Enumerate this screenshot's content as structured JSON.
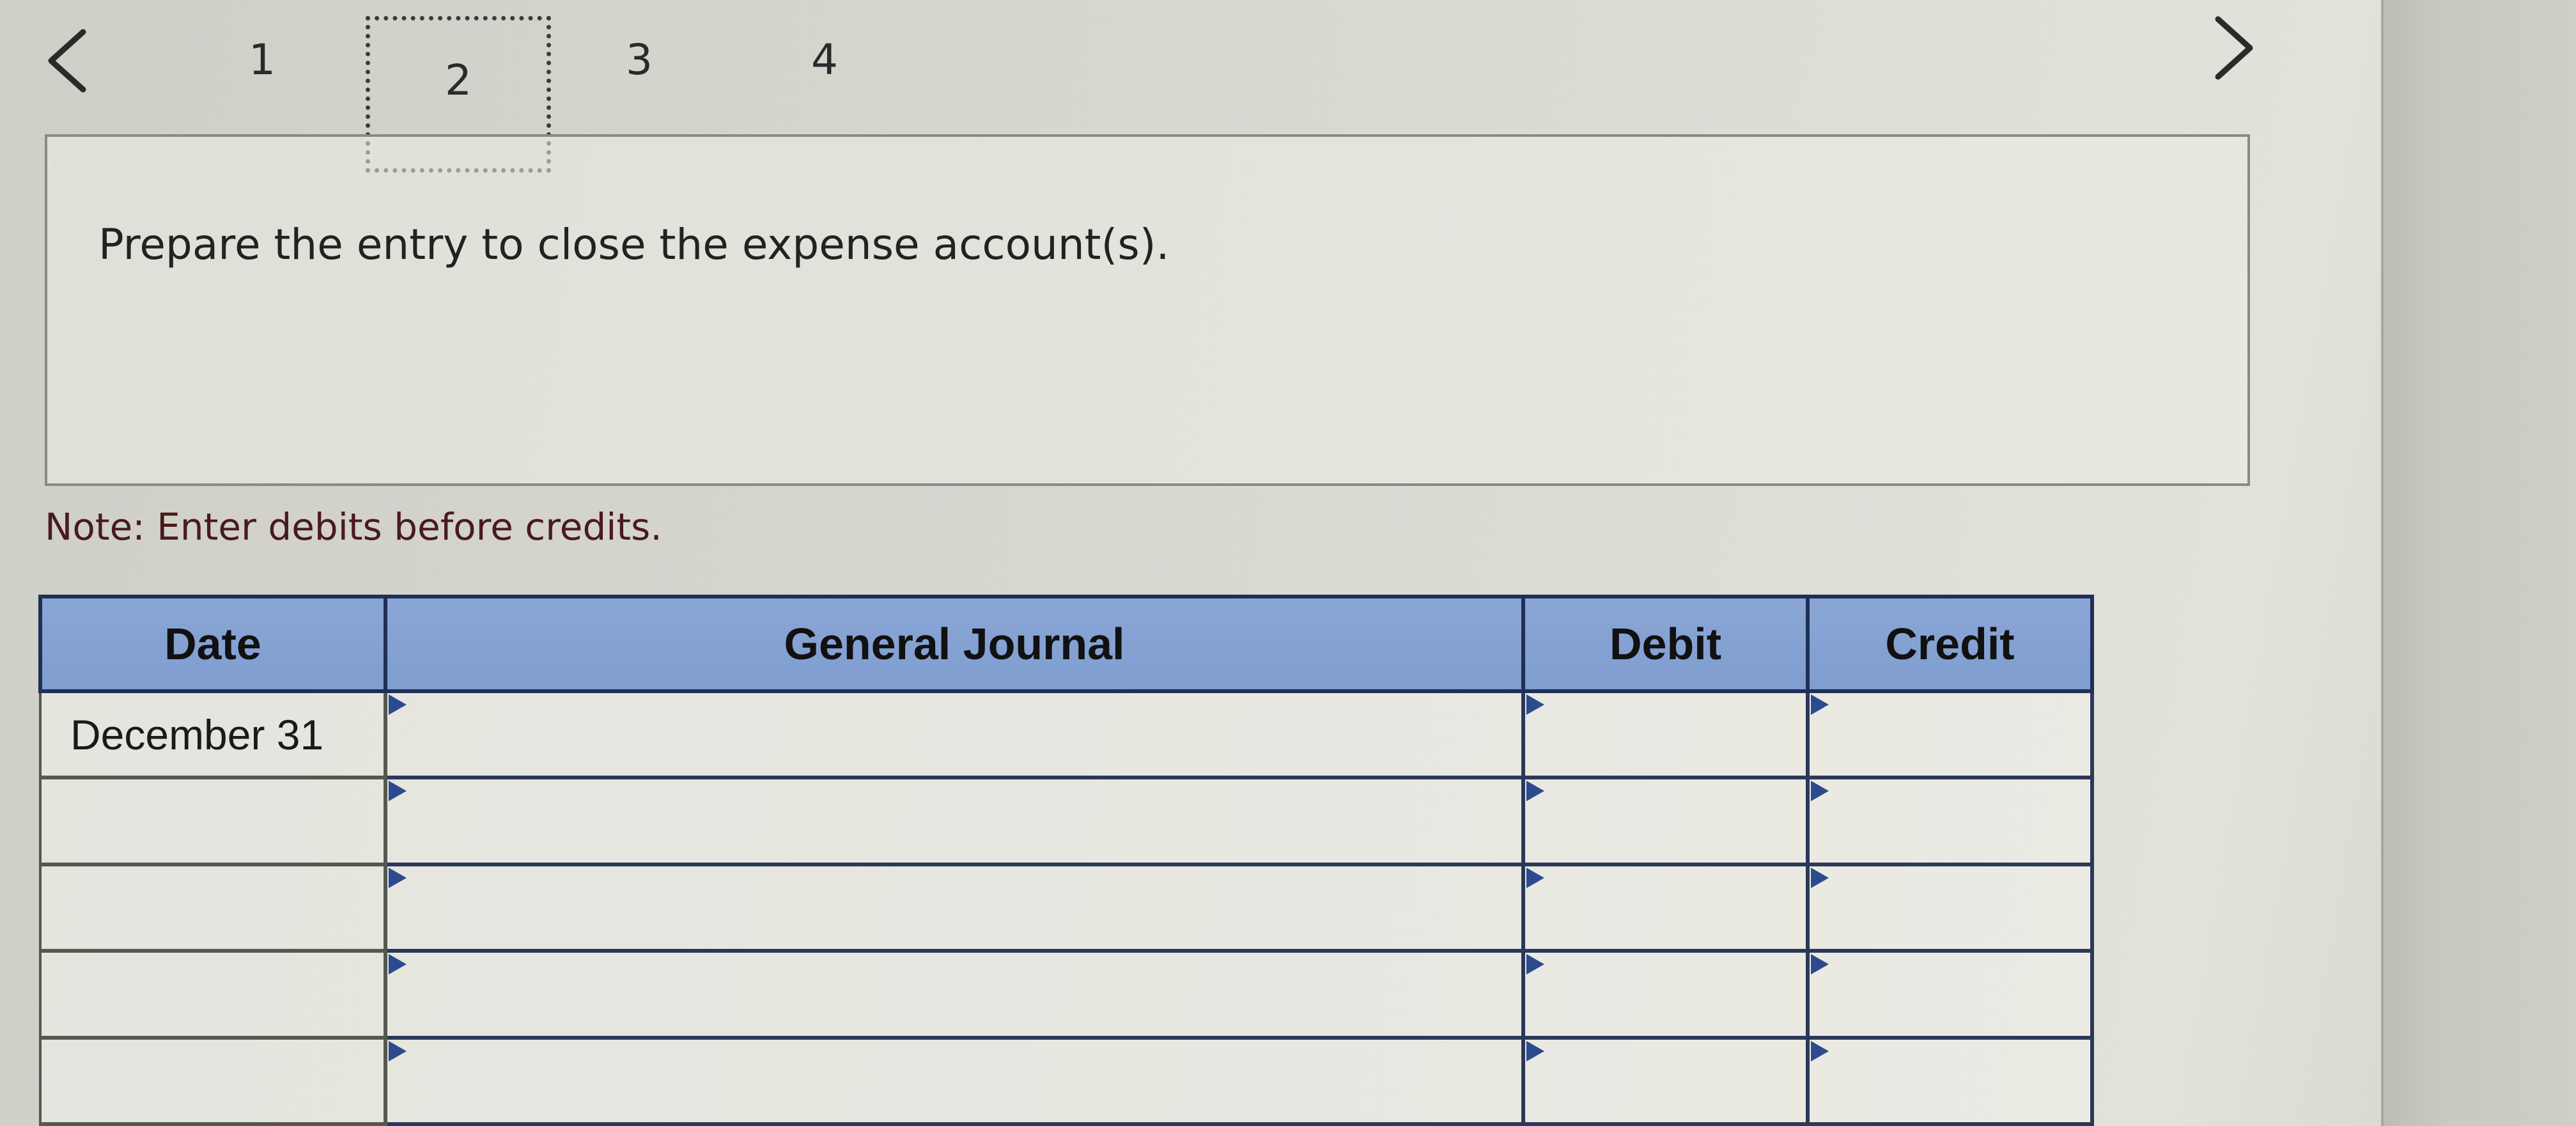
{
  "pagination": {
    "prev_icon": "chevron-left-icon",
    "next_icon": "chevron-right-icon",
    "tabs": [
      {
        "label": "1",
        "active": false
      },
      {
        "label": "2",
        "active": true
      },
      {
        "label": "3",
        "active": false
      },
      {
        "label": "4",
        "active": false
      }
    ]
  },
  "instruction": {
    "text": "Prepare the entry to close the expense account(s)."
  },
  "note": {
    "text": "Note: Enter debits before credits."
  },
  "journal": {
    "headers": {
      "date": "Date",
      "general_journal": "General Journal",
      "debit": "Debit",
      "credit": "Credit"
    },
    "rows": [
      {
        "date": "December 31",
        "account": "",
        "debit": "",
        "credit": ""
      },
      {
        "date": "",
        "account": "",
        "debit": "",
        "credit": ""
      },
      {
        "date": "",
        "account": "",
        "debit": "",
        "credit": ""
      },
      {
        "date": "",
        "account": "",
        "debit": "",
        "credit": ""
      },
      {
        "date": "",
        "account": "",
        "debit": "",
        "credit": ""
      }
    ]
  },
  "colors": {
    "header_blue": "#8aa6d6",
    "border_navy": "#1f2f55",
    "flag_blue": "#2c4b8f",
    "note_text": "#4a1a1a"
  }
}
